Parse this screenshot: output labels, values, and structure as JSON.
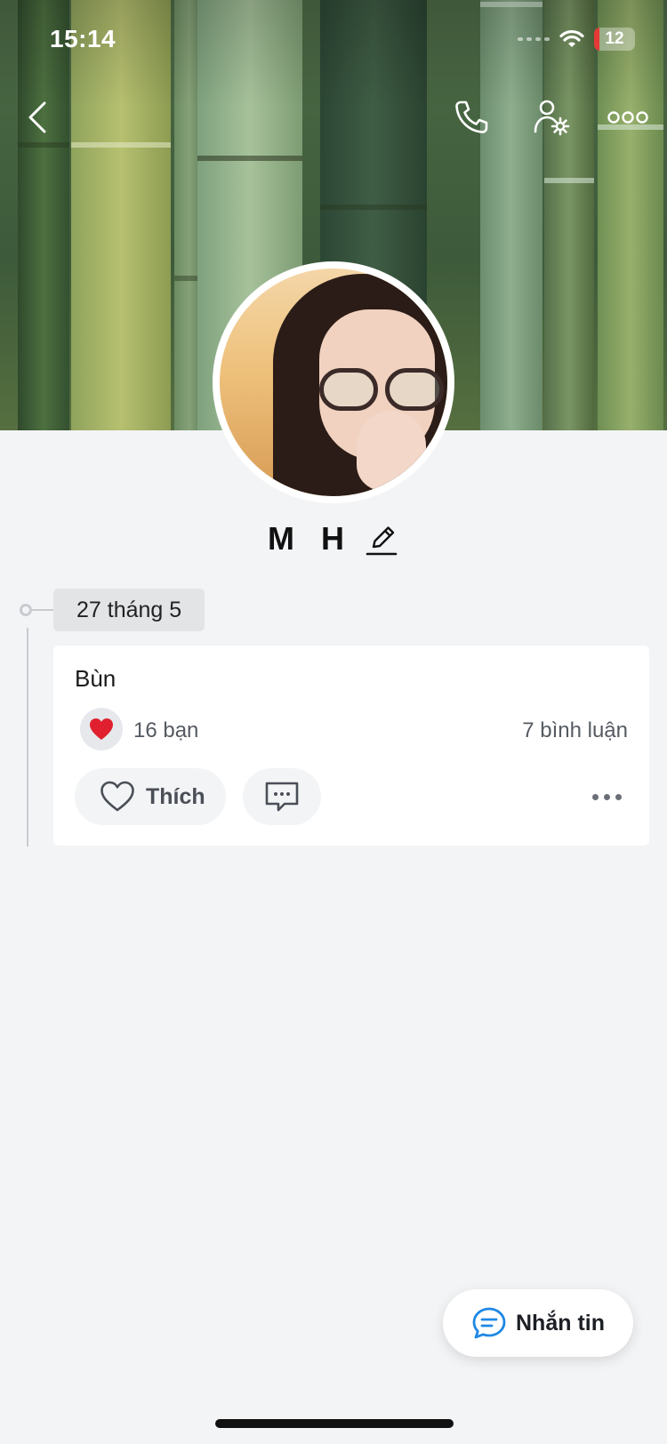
{
  "status_bar": {
    "time": "15:14",
    "battery_level": "12",
    "battery_fraction": 0.12
  },
  "nav": {
    "icons": [
      "chevron-left-icon",
      "phone-icon",
      "user-settings-icon",
      "more-horizontal-icon"
    ]
  },
  "profile": {
    "name": "M H"
  },
  "timeline": {
    "date_label": "27 tháng 5"
  },
  "post": {
    "text": "Bùn",
    "reaction_summary": "16 bạn",
    "comment_summary": "7 bình luận",
    "like_label": "Thích"
  },
  "floating_action": {
    "label": "Nhắn tin"
  },
  "colors": {
    "accent": "#1e88e5",
    "heart": "#e0202e",
    "page_background": "#f3f4f6"
  }
}
